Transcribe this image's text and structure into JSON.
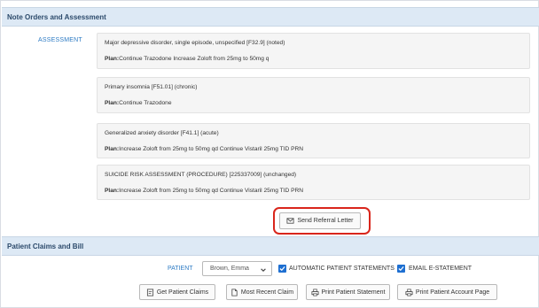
{
  "notes_section": {
    "title": "Note Orders and Assessment",
    "assessment_label": "ASSESSMENT",
    "items": [
      {
        "diagnosis": "Major depressive disorder, single episode, unspecified [F32.9] (noted)",
        "plan_label": "Plan:",
        "plan_text": "Continue Trazodone Increase Zoloft from 25mg to 50mg q"
      },
      {
        "diagnosis": "Primary insomnia [F51.01] (chronic)",
        "plan_label": "Plan:",
        "plan_text": "Continue Trazodone"
      },
      {
        "diagnosis": "Generalized anxiety disorder [F41.1] (acute)",
        "plan_label": "Plan:",
        "plan_text": "Increase Zoloft from 25mg to 50mg qd Continue Vistaril 25mg TID PRN"
      },
      {
        "diagnosis": "SUICIDE RISK ASSESSMENT (PROCEDURE) [225337009] (unchanged)",
        "plan_label": "Plan:",
        "plan_text": "Increase Zoloft from 25mg to 50mg qd Continue Vistaril 25mg TID PRN"
      }
    ],
    "send_referral_label": "Send Referral Letter",
    "send_referral_icon": "envelope-icon",
    "highlight_color": "#d9261c"
  },
  "claims_section": {
    "title": "Patient Claims and Bill",
    "patient_label": "PATIENT",
    "patient_value": "Brown, Emma",
    "auto_statements_label": "AUTOMATIC PATIENT STATEMENTS",
    "auto_statements_checked": true,
    "email_statement_label": "EMAIL E-STATEMENT",
    "email_statement_checked": true,
    "buttons": {
      "get_claims": "Get Patient Claims",
      "recent_claim": "Most Recent Claim",
      "print_statement": "Print Patient Statement",
      "print_account": "Print Patient Account Page"
    }
  },
  "colors": {
    "accent": "#2d7bc4",
    "header_bg": "#dde9f5",
    "checkbox": "#1e6fd1"
  }
}
